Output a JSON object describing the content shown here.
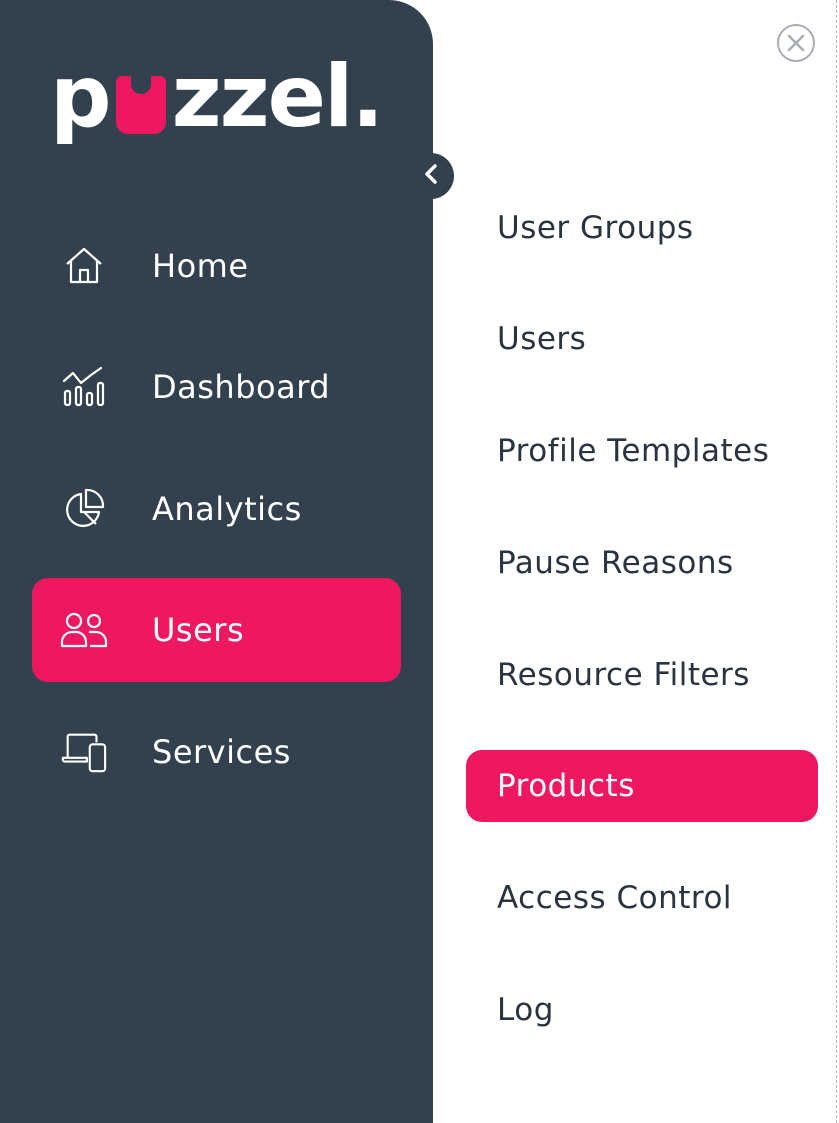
{
  "brand": {
    "logo_text_before": "p",
    "logo_text_after": "zzel.",
    "accent_color": "#ee1861",
    "sidebar_color": "#33404d"
  },
  "sidebar": {
    "items": [
      {
        "label": "Home",
        "icon": "home-icon",
        "active": false
      },
      {
        "label": "Dashboard",
        "icon": "dashboard-icon",
        "active": false
      },
      {
        "label": "Analytics",
        "icon": "pie-chart-icon",
        "active": false
      },
      {
        "label": "Users",
        "icon": "users-icon",
        "active": true
      },
      {
        "label": "Services",
        "icon": "devices-icon",
        "active": false
      }
    ]
  },
  "submenu": {
    "items": [
      {
        "label": "User Groups",
        "active": false
      },
      {
        "label": "Users",
        "active": false
      },
      {
        "label": "Profile Templates",
        "active": false
      },
      {
        "label": "Pause Reasons",
        "active": false
      },
      {
        "label": "Resource Filters",
        "active": false
      },
      {
        "label": "Products",
        "active": true
      },
      {
        "label": "Access Control",
        "active": false
      },
      {
        "label": "Log",
        "active": false
      }
    ]
  }
}
